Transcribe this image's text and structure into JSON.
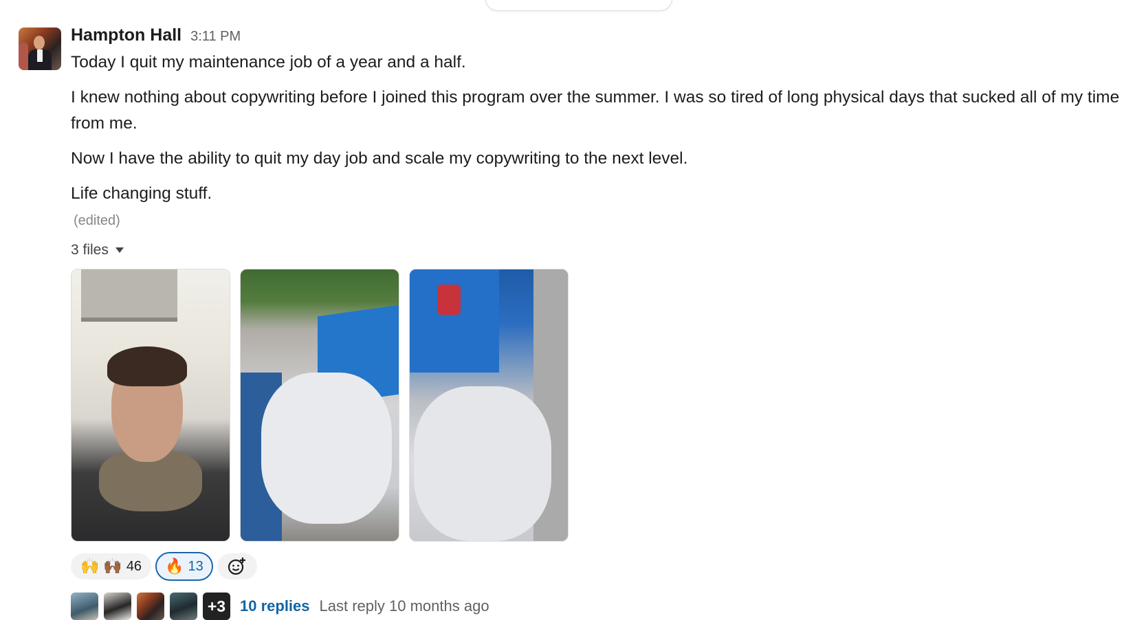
{
  "message": {
    "author": "Hampton Hall",
    "timestamp": "3:11 PM",
    "paragraphs": [
      "Today I quit my maintenance job of a year and a half.",
      "I knew nothing about copywriting before I joined this program over the summer. I was so tired of long physical days that sucked all of my time from me.",
      "Now I have the ability to quit my day job and scale my copywriting to the next level.",
      "Life changing stuff."
    ],
    "edited_label": "(edited)"
  },
  "files": {
    "toggle_label": "3 files",
    "items": [
      {
        "icon": "selfie-photo"
      },
      {
        "icon": "dumpster-bags-photo"
      },
      {
        "icon": "dumpster-closeup-photo"
      }
    ]
  },
  "reactions": [
    {
      "emoji": "🙌",
      "emoji2": "🙌🏾",
      "count": "46",
      "active": false
    },
    {
      "emoji": "🔥",
      "count": "13",
      "active": true
    }
  ],
  "add_reaction_icon": "add-emoji-icon",
  "thread": {
    "more_count": "+3",
    "replies_label": "10 replies",
    "last_reply": "Last reply 10 months ago"
  },
  "colors": {
    "link": "#1264a3",
    "active_reaction_border": "#1d64a8",
    "active_reaction_bg": "#eaf3fb"
  }
}
